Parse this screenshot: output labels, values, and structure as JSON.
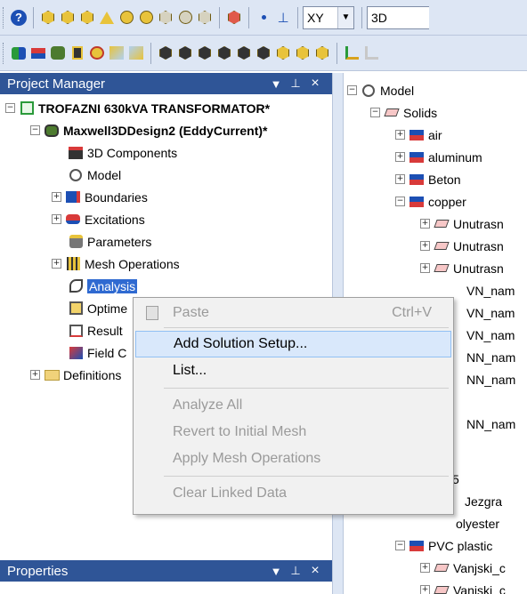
{
  "toolbar1": {
    "plane_value": "XY",
    "view_value": "3D"
  },
  "project_manager": {
    "title": "Project Manager",
    "pin_glyph": "↓ †",
    "close_glyph": "×",
    "project": "TROFAZNI 630kVA TRANSFORMATOR*",
    "design": "Maxwell3DDesign2 (EddyCurrent)*",
    "items": [
      "3D Components",
      "Model",
      "Boundaries",
      "Excitations",
      "Parameters",
      "Mesh Operations",
      "Analysis",
      "Optime",
      "Result",
      "Field C",
      "Definitions"
    ]
  },
  "properties": {
    "title": "Properties"
  },
  "model_tree": {
    "root": "Model",
    "solids": "Solids",
    "materials": [
      "air",
      "aluminum",
      "Beton",
      "copper"
    ],
    "copper_children": [
      "Unutrasn",
      "Unutrasn",
      "Unutrasn",
      "VN_nam",
      "VN_nam",
      "VN_nam",
      "NN_nam",
      "NN_nam",
      "NN_nam"
    ],
    "partial_label": "5",
    "jezgra": "Jezgra",
    "polyester": "olyester",
    "pvc": "PVC plastic",
    "pvc_children": [
      "Vanjski_c",
      "Vanjski_c"
    ]
  },
  "context_menu": {
    "paste": "Paste",
    "paste_shortcut": "Ctrl+V",
    "add_solution_setup": "Add Solution Setup...",
    "list": "List...",
    "analyze_all": "Analyze All",
    "revert_mesh": "Revert to Initial Mesh",
    "apply_mesh_ops": "Apply Mesh Operations",
    "clear_linked": "Clear Linked Data"
  },
  "colors": {
    "panel_header": "#2f5597",
    "toolbar_bg": "#dde6f4",
    "menu_highlight": "#d9e8fb",
    "icon_gold": "#e8c33b"
  }
}
